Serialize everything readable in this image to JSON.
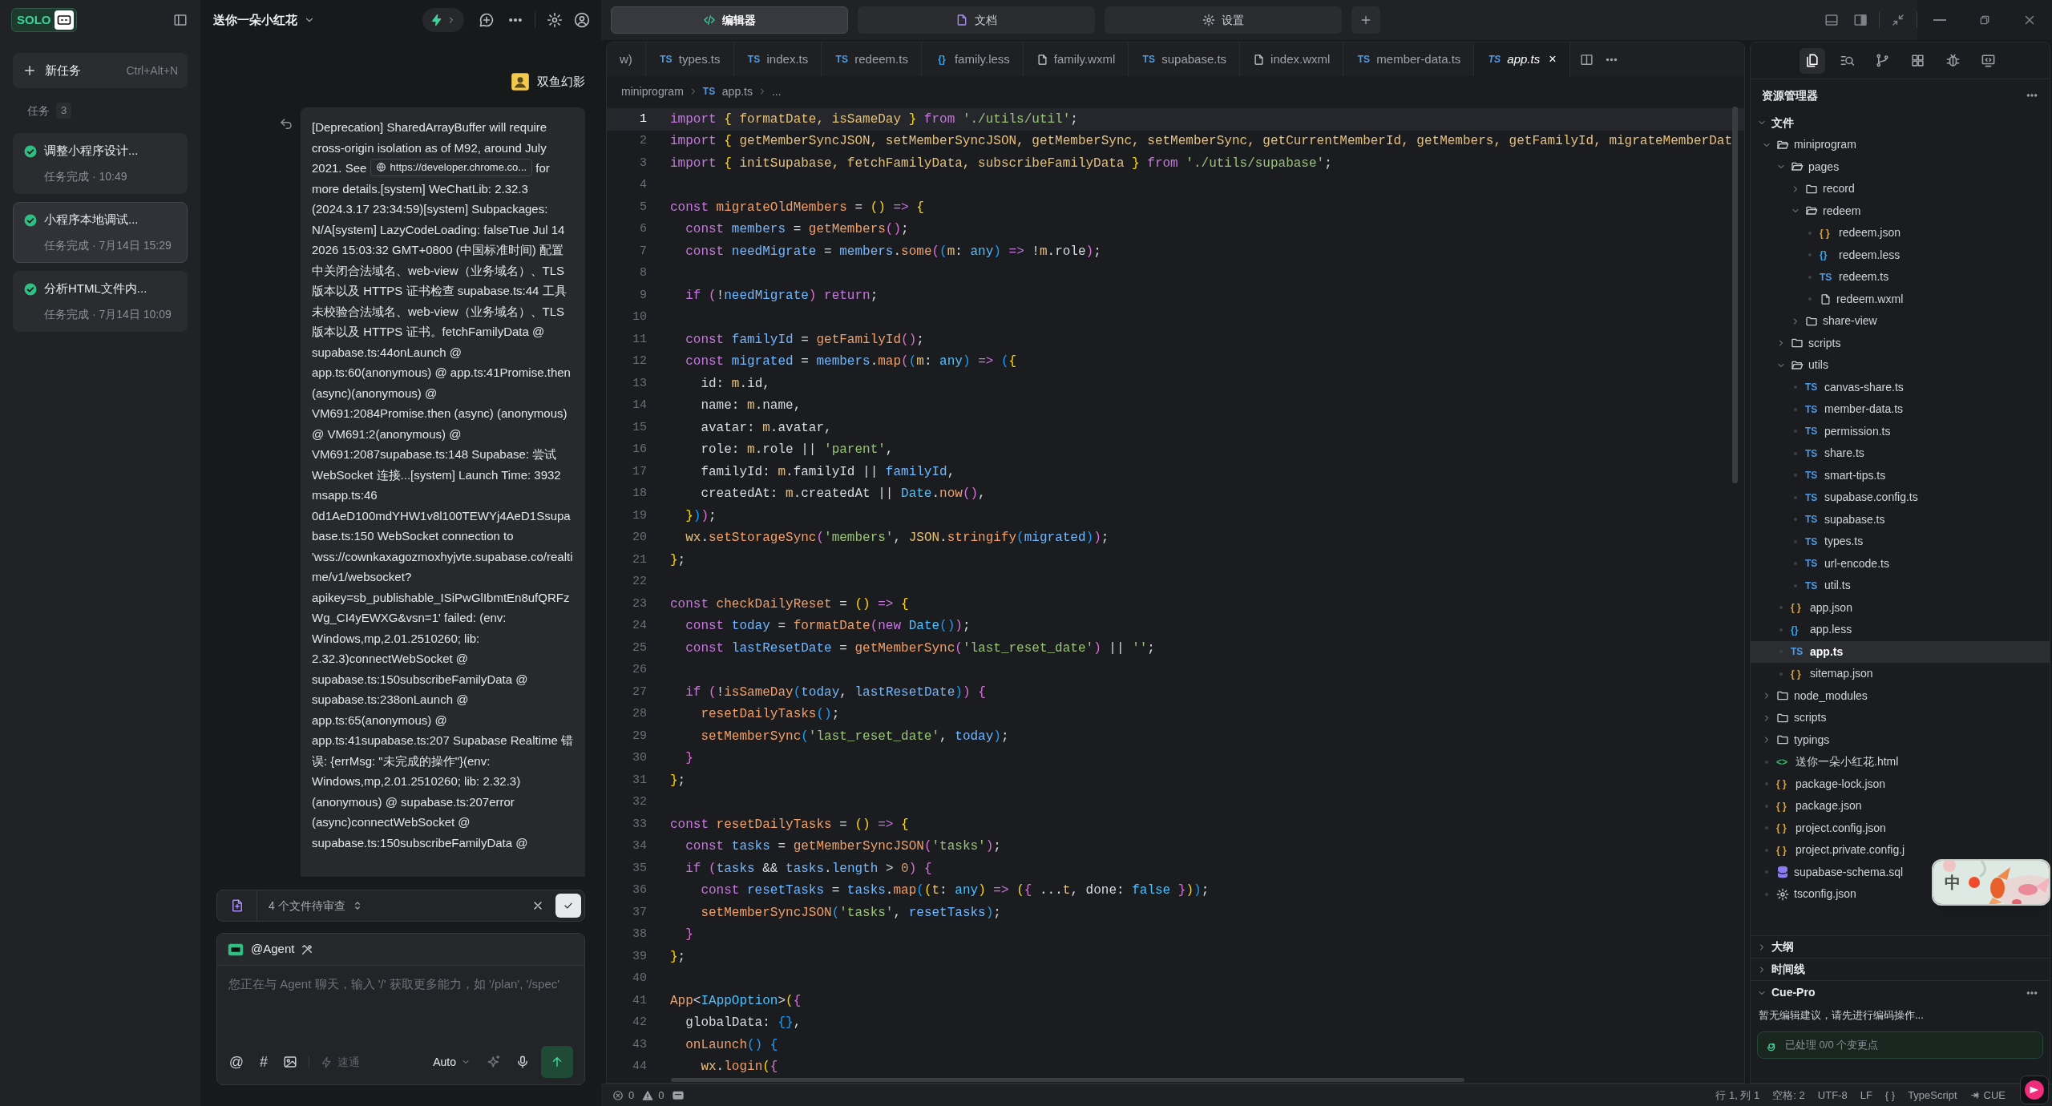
{
  "sidebar": {
    "logo": "SOLO",
    "new_task": {
      "label": "新任务",
      "shortcut": "Ctrl+Alt+N"
    },
    "tasks_heading": "任务",
    "tasks_count": "3",
    "tasks": [
      {
        "title": "调整小程序设计...",
        "status": "任务完成 · 10:49",
        "selected": false
      },
      {
        "title": "小程序本地调试...",
        "status": "任务完成 · 7月14日 15:29",
        "selected": true
      },
      {
        "title": "分析HTML文件内...",
        "status": "任务完成 · 7月14日 10:09",
        "selected": false
      }
    ]
  },
  "chat": {
    "title": "送你一朵小红花",
    "user": "双鱼幻影",
    "message": [
      {
        "kind": "text",
        "text": "[Deprecation] SharedArrayBuffer will require cross-origin isolation as of M92, around July 2021. See "
      },
      {
        "kind": "link",
        "text": "https://developer.chrome.co..."
      },
      {
        "kind": "text",
        "text": " for more details.[system] WeChatLib: 2.32.3 (2024.3.17 23:34:59)[system] Subpackages: N/A[system] LazyCodeLoading: falseTue Jul 14 2026 15:03:32 GMT+0800 (中国标准时间) 配置中关闭合法域名、web-view（业务域名）、TLS 版本以及 HTTPS 证书检查 supabase.ts:44 工具未校验合法域名、web-view（业务域名）、TLS 版本以及 HTTPS 证书。fetchFamilyData @ supabase.ts:44onLaunch @ app.ts:60(anonymous) @ app.ts:41Promise.then (async)(anonymous) @ VM691:2084Promise.then (async) (anonymous) @ VM691:2(anonymous) @ VM691:2087supabase.ts:148 Supabase: 尝试 WebSocket 连接...[system] Launch Time: 3932 msapp.ts:46 0d1AeD100mdYHW1v8l100TEWYj4AeD1Ssupabase.ts:150 WebSocket connection to 'wss://cownkaxagozmoxhyjvte.supabase.co/realtime/v1/websocket?apikey=sb_publishable_ISiPwGlIbmtEn8ufQRFzWg_CI4yEWXG&vsn=1' failed: (env: Windows,mp,2.01.2510260; lib: 2.32.3)connectWebSocket @ supabase.ts:150subscribeFamilyData @ supabase.ts:238onLaunch @ app.ts:65(anonymous) @ app.ts:41supabase.ts:207 Supabase Realtime 错误: {errMsg: \"未完成的操作\"}(env: Windows,mp,2.01.2510260; lib: 2.32.3) (anonymous) @ supabase.ts:207error (async)connectWebSocket @ supabase.ts:150subscribeFamilyData @"
      }
    ],
    "review": {
      "label": "4 个文件待审查"
    },
    "composer": {
      "agent": "@Agent",
      "placeholder": "您正在与 Agent 聊天，输入 '/' 获取更多能力，如 '/plan', '/spec'",
      "tools": [
        "@",
        "#"
      ],
      "mode": {
        "label": "速通",
        "disabled": true
      },
      "model": "Auto"
    }
  },
  "editor": {
    "tabs": [
      {
        "label": "编辑器",
        "selected": true
      },
      {
        "label": "文档",
        "selected": false
      },
      {
        "label": "设置",
        "selected": false
      }
    ],
    "file_tabs": [
      {
        "label": "w)",
        "kind": "partial",
        "selected": false
      },
      {
        "label": "types.ts",
        "kind": "ts",
        "icon": "TS",
        "selected": false
      },
      {
        "label": "index.ts",
        "kind": "ts",
        "icon": "TS",
        "selected": false
      },
      {
        "label": "redeem.ts",
        "kind": "ts",
        "icon": "TS",
        "selected": false
      },
      {
        "label": "family.less",
        "kind": "less",
        "icon": "{}",
        "selected": false
      },
      {
        "label": "family.wxml",
        "kind": "doc",
        "selected": false
      },
      {
        "label": "supabase.ts",
        "kind": "ts",
        "icon": "TS",
        "selected": false
      },
      {
        "label": "index.wxml",
        "kind": "doc",
        "selected": false
      },
      {
        "label": "member-data.ts",
        "kind": "ts",
        "icon": "TS",
        "selected": false
      },
      {
        "label": "app.ts",
        "kind": "ts",
        "icon": "TS",
        "selected": true,
        "close": "×"
      }
    ],
    "breadcrumb": [
      {
        "label": "miniprogram",
        "kind": "folder"
      },
      {
        "label": "app.ts",
        "kind": "ts",
        "icon": "TS"
      },
      {
        "label": "...",
        "kind": "more"
      }
    ],
    "lines": [
      {
        "number": "1",
        "current": true,
        "code": [
          {
            "text": "import ",
            "kind": "keyword"
          },
          {
            "text": "{ ",
            "kind": "bracket1"
          },
          {
            "text": "formatDate, isSameDay ",
            "kind": "import"
          },
          {
            "text": "} ",
            "kind": "bracket1"
          },
          {
            "text": "from ",
            "kind": "keyword"
          },
          {
            "text": "'./utils/util'",
            "kind": "string"
          },
          {
            "text": ";",
            "kind": "plain"
          }
        ]
      },
      {
        "number": "2",
        "current": false,
        "code": [
          {
            "text": "import ",
            "kind": "keyword"
          },
          {
            "text": "{ ",
            "kind": "bracket1"
          },
          {
            "text": "getMemberSyncJSON, setMemberSyncJSON, getMemberSync, setMemberSync, getCurrentMemberId, getMembers, getFamilyId, migrateMemberDat",
            "kind": "import"
          }
        ]
      },
      {
        "number": "3",
        "current": false,
        "code": [
          {
            "text": "import ",
            "kind": "keyword"
          },
          {
            "text": "{ ",
            "kind": "bracket1"
          },
          {
            "text": "initSupabase, fetchFamilyData, subscribeFamilyData ",
            "kind": "import"
          },
          {
            "text": "} ",
            "kind": "bracket1"
          },
          {
            "text": "from ",
            "kind": "keyword"
          },
          {
            "text": "'./utils/supabase'",
            "kind": "string"
          },
          {
            "text": ";",
            "kind": "plain"
          }
        ]
      },
      {
        "number": "4",
        "current": false
      },
      {
        "number": "5",
        "current": false,
        "code": [
          {
            "text": "const ",
            "kind": "keyword"
          },
          {
            "text": "migrateOldMembers",
            "kind": "call"
          },
          {
            "text": " = ",
            "kind": "plain"
          },
          {
            "text": "() ",
            "kind": "bracket1"
          },
          {
            "text": "=> ",
            "kind": "keyword"
          },
          {
            "text": "{",
            "kind": "bracket1"
          }
        ]
      },
      {
        "number": "6",
        "current": false,
        "code": [
          {
            "text": "  const ",
            "kind": "keyword"
          },
          {
            "text": "members",
            "kind": "variable"
          },
          {
            "text": " = ",
            "kind": "plain"
          },
          {
            "text": "getMembers",
            "kind": "call"
          },
          {
            "text": "()",
            "kind": "bracket2"
          },
          {
            "text": ";",
            "kind": "plain"
          }
        ]
      },
      {
        "number": "7",
        "current": false,
        "code": [
          {
            "text": "  const ",
            "kind": "keyword"
          },
          {
            "text": "needMigrate",
            "kind": "variable"
          },
          {
            "text": " = ",
            "kind": "plain"
          },
          {
            "text": "members",
            "kind": "variable"
          },
          {
            "text": ".",
            "kind": "plain"
          },
          {
            "text": "some",
            "kind": "call"
          },
          {
            "text": "(",
            "kind": "bracket2"
          },
          {
            "text": "(",
            "kind": "bracket3"
          },
          {
            "text": "m",
            "kind": "param"
          },
          {
            "text": ": ",
            "kind": "plain"
          },
          {
            "text": "any",
            "kind": "type"
          },
          {
            "text": ") ",
            "kind": "bracket3"
          },
          {
            "text": "=> ",
            "kind": "keyword"
          },
          {
            "text": "!",
            "kind": "plain"
          },
          {
            "text": "m",
            "kind": "param"
          },
          {
            "text": ".role",
            "kind": "plain"
          },
          {
            "text": ")",
            "kind": "bracket2"
          },
          {
            "text": ";",
            "kind": "plain"
          }
        ]
      },
      {
        "number": "8",
        "current": false
      },
      {
        "number": "9",
        "current": false,
        "code": [
          {
            "text": "  if ",
            "kind": "keyword"
          },
          {
            "text": "(",
            "kind": "bracket2"
          },
          {
            "text": "!",
            "kind": "plain"
          },
          {
            "text": "needMigrate",
            "kind": "variable"
          },
          {
            "text": ") ",
            "kind": "bracket2"
          },
          {
            "text": "return",
            "kind": "keyword"
          },
          {
            "text": ";",
            "kind": "plain"
          }
        ]
      },
      {
        "number": "10",
        "current": false
      },
      {
        "number": "11",
        "current": false,
        "code": [
          {
            "text": "  const ",
            "kind": "keyword"
          },
          {
            "text": "familyId",
            "kind": "variable"
          },
          {
            "text": " = ",
            "kind": "plain"
          },
          {
            "text": "getFamilyId",
            "kind": "call"
          },
          {
            "text": "()",
            "kind": "bracket2"
          },
          {
            "text": ";",
            "kind": "plain"
          }
        ]
      },
      {
        "number": "12",
        "current": false,
        "code": [
          {
            "text": "  const ",
            "kind": "keyword"
          },
          {
            "text": "migrated",
            "kind": "variable"
          },
          {
            "text": " = ",
            "kind": "plain"
          },
          {
            "text": "members",
            "kind": "variable"
          },
          {
            "text": ".",
            "kind": "plain"
          },
          {
            "text": "map",
            "kind": "call"
          },
          {
            "text": "(",
            "kind": "bracket2"
          },
          {
            "text": "(",
            "kind": "bracket3"
          },
          {
            "text": "m",
            "kind": "param"
          },
          {
            "text": ": ",
            "kind": "plain"
          },
          {
            "text": "any",
            "kind": "type"
          },
          {
            "text": ") ",
            "kind": "bracket3"
          },
          {
            "text": "=> ",
            "kind": "keyword"
          },
          {
            "text": "(",
            "kind": "bracket3"
          },
          {
            "text": "{",
            "kind": "bracket1"
          }
        ]
      },
      {
        "number": "13",
        "current": false,
        "code": [
          {
            "text": "    id: ",
            "kind": "plain"
          },
          {
            "text": "m",
            "kind": "param"
          },
          {
            "text": ".id,",
            "kind": "plain"
          }
        ]
      },
      {
        "number": "14",
        "current": false,
        "code": [
          {
            "text": "    name: ",
            "kind": "plain"
          },
          {
            "text": "m",
            "kind": "param"
          },
          {
            "text": ".name,",
            "kind": "plain"
          }
        ]
      },
      {
        "number": "15",
        "current": false,
        "code": [
          {
            "text": "    avatar: ",
            "kind": "plain"
          },
          {
            "text": "m",
            "kind": "param"
          },
          {
            "text": ".avatar,",
            "kind": "plain"
          }
        ]
      },
      {
        "number": "16",
        "current": false,
        "code": [
          {
            "text": "    role: ",
            "kind": "plain"
          },
          {
            "text": "m",
            "kind": "param"
          },
          {
            "text": ".role || ",
            "kind": "plain"
          },
          {
            "text": "'parent'",
            "kind": "string"
          },
          {
            "text": ",",
            "kind": "plain"
          }
        ]
      },
      {
        "number": "17",
        "current": false,
        "code": [
          {
            "text": "    familyId: ",
            "kind": "plain"
          },
          {
            "text": "m",
            "kind": "param"
          },
          {
            "text": ".familyId || ",
            "kind": "plain"
          },
          {
            "text": "familyId",
            "kind": "variable"
          },
          {
            "text": ",",
            "kind": "plain"
          }
        ]
      },
      {
        "number": "18",
        "current": false,
        "code": [
          {
            "text": "    createdAt: ",
            "kind": "plain"
          },
          {
            "text": "m",
            "kind": "param"
          },
          {
            "text": ".createdAt || ",
            "kind": "plain"
          },
          {
            "text": "Date",
            "kind": "type"
          },
          {
            "text": ".",
            "kind": "plain"
          },
          {
            "text": "now",
            "kind": "call"
          },
          {
            "text": "()",
            "kind": "bracket2"
          },
          {
            "text": ",",
            "kind": "plain"
          }
        ]
      },
      {
        "number": "19",
        "current": false,
        "code": [
          {
            "text": "  }",
            "kind": "bracket1"
          },
          {
            "text": ")",
            "kind": "bracket3"
          },
          {
            "text": ")",
            "kind": "bracket2"
          },
          {
            "text": ";",
            "kind": "plain"
          }
        ]
      },
      {
        "number": "20",
        "current": false,
        "code": [
          {
            "text": "  wx",
            "kind": "import"
          },
          {
            "text": ".",
            "kind": "plain"
          },
          {
            "text": "setStorageSync",
            "kind": "call"
          },
          {
            "text": "(",
            "kind": "bracket2"
          },
          {
            "text": "'members'",
            "kind": "string"
          },
          {
            "text": ", ",
            "kind": "plain"
          },
          {
            "text": "JSON",
            "kind": "import"
          },
          {
            "text": ".",
            "kind": "plain"
          },
          {
            "text": "stringify",
            "kind": "call"
          },
          {
            "text": "(",
            "kind": "bracket3"
          },
          {
            "text": "migrated",
            "kind": "variable"
          },
          {
            "text": ")",
            "kind": "bracket3"
          },
          {
            "text": ")",
            "kind": "bracket2"
          },
          {
            "text": ";",
            "kind": "plain"
          }
        ]
      },
      {
        "number": "21",
        "current": false,
        "code": [
          {
            "text": "}",
            "kind": "bracket1"
          },
          {
            "text": ";",
            "kind": "plain"
          }
        ]
      },
      {
        "number": "22",
        "current": false
      },
      {
        "number": "23",
        "current": false,
        "code": [
          {
            "text": "const ",
            "kind": "keyword"
          },
          {
            "text": "checkDailyReset",
            "kind": "call"
          },
          {
            "text": " = ",
            "kind": "plain"
          },
          {
            "text": "() ",
            "kind": "bracket1"
          },
          {
            "text": "=> ",
            "kind": "keyword"
          },
          {
            "text": "{",
            "kind": "bracket1"
          }
        ]
      },
      {
        "number": "24",
        "current": false,
        "code": [
          {
            "text": "  const ",
            "kind": "keyword"
          },
          {
            "text": "today",
            "kind": "variable"
          },
          {
            "text": " = ",
            "kind": "plain"
          },
          {
            "text": "formatDate",
            "kind": "call"
          },
          {
            "text": "(",
            "kind": "bracket2"
          },
          {
            "text": "new ",
            "kind": "keyword"
          },
          {
            "text": "Date",
            "kind": "type"
          },
          {
            "text": "()",
            "kind": "bracket3"
          },
          {
            "text": ")",
            "kind": "bracket2"
          },
          {
            "text": ";",
            "kind": "plain"
          }
        ]
      },
      {
        "number": "25",
        "current": false,
        "code": [
          {
            "text": "  const ",
            "kind": "keyword"
          },
          {
            "text": "lastResetDate",
            "kind": "variable"
          },
          {
            "text": " = ",
            "kind": "plain"
          },
          {
            "text": "getMemberSync",
            "kind": "call"
          },
          {
            "text": "(",
            "kind": "bracket2"
          },
          {
            "text": "'last_reset_date'",
            "kind": "string"
          },
          {
            "text": ")",
            "kind": "bracket2"
          },
          {
            "text": " || ",
            "kind": "plain"
          },
          {
            "text": "''",
            "kind": "string"
          },
          {
            "text": ";",
            "kind": "plain"
          }
        ]
      },
      {
        "number": "26",
        "current": false
      },
      {
        "number": "27",
        "current": false,
        "code": [
          {
            "text": "  if ",
            "kind": "keyword"
          },
          {
            "text": "(",
            "kind": "bracket2"
          },
          {
            "text": "!",
            "kind": "plain"
          },
          {
            "text": "isSameDay",
            "kind": "call"
          },
          {
            "text": "(",
            "kind": "bracket3"
          },
          {
            "text": "today",
            "kind": "variable"
          },
          {
            "text": ", ",
            "kind": "plain"
          },
          {
            "text": "lastResetDate",
            "kind": "variable"
          },
          {
            "text": ")",
            "kind": "bracket3"
          },
          {
            "text": ") ",
            "kind": "bracket2"
          },
          {
            "text": "{",
            "kind": "bracket2"
          }
        ]
      },
      {
        "number": "28",
        "current": false,
        "code": [
          {
            "text": "    resetDailyTasks",
            "kind": "call"
          },
          {
            "text": "()",
            "kind": "bracket3"
          },
          {
            "text": ";",
            "kind": "plain"
          }
        ]
      },
      {
        "number": "29",
        "current": false,
        "code": [
          {
            "text": "    setMemberSync",
            "kind": "call"
          },
          {
            "text": "(",
            "kind": "bracket3"
          },
          {
            "text": "'last_reset_date'",
            "kind": "string"
          },
          {
            "text": ", ",
            "kind": "plain"
          },
          {
            "text": "today",
            "kind": "variable"
          },
          {
            "text": ")",
            "kind": "bracket3"
          },
          {
            "text": ";",
            "kind": "plain"
          }
        ]
      },
      {
        "number": "30",
        "current": false,
        "code": [
          {
            "text": "  }",
            "kind": "bracket2"
          }
        ]
      },
      {
        "number": "31",
        "current": false,
        "code": [
          {
            "text": "}",
            "kind": "bracket1"
          },
          {
            "text": ";",
            "kind": "plain"
          }
        ]
      },
      {
        "number": "32",
        "current": false
      },
      {
        "number": "33",
        "current": false,
        "code": [
          {
            "text": "const ",
            "kind": "keyword"
          },
          {
            "text": "resetDailyTasks",
            "kind": "call"
          },
          {
            "text": " = ",
            "kind": "plain"
          },
          {
            "text": "() ",
            "kind": "bracket1"
          },
          {
            "text": "=> ",
            "kind": "keyword"
          },
          {
            "text": "{",
            "kind": "bracket1"
          }
        ]
      },
      {
        "number": "34",
        "current": false,
        "code": [
          {
            "text": "  const ",
            "kind": "keyword"
          },
          {
            "text": "tasks",
            "kind": "variable"
          },
          {
            "text": " = ",
            "kind": "plain"
          },
          {
            "text": "getMemberSyncJSON",
            "kind": "call"
          },
          {
            "text": "(",
            "kind": "bracket2"
          },
          {
            "text": "'tasks'",
            "kind": "string"
          },
          {
            "text": ")",
            "kind": "bracket2"
          },
          {
            "text": ";",
            "kind": "plain"
          }
        ]
      },
      {
        "number": "35",
        "current": false,
        "code": [
          {
            "text": "  if ",
            "kind": "keyword"
          },
          {
            "text": "(",
            "kind": "bracket2"
          },
          {
            "text": "tasks",
            "kind": "variable"
          },
          {
            "text": " && ",
            "kind": "plain"
          },
          {
            "text": "tasks",
            "kind": "variable"
          },
          {
            "text": ".",
            "kind": "plain"
          },
          {
            "text": "length",
            "kind": "variable"
          },
          {
            "text": " > ",
            "kind": "plain"
          },
          {
            "text": "0",
            "kind": "number"
          },
          {
            "text": ") ",
            "kind": "bracket2"
          },
          {
            "text": "{",
            "kind": "bracket2"
          }
        ]
      },
      {
        "number": "36",
        "current": false,
        "code": [
          {
            "text": "    const ",
            "kind": "keyword"
          },
          {
            "text": "resetTasks",
            "kind": "variable"
          },
          {
            "text": " = ",
            "kind": "plain"
          },
          {
            "text": "tasks",
            "kind": "variable"
          },
          {
            "text": ".",
            "kind": "plain"
          },
          {
            "text": "map",
            "kind": "call"
          },
          {
            "text": "(",
            "kind": "bracket3"
          },
          {
            "text": "(",
            "kind": "bracket1"
          },
          {
            "text": "t",
            "kind": "param"
          },
          {
            "text": ": ",
            "kind": "plain"
          },
          {
            "text": "any",
            "kind": "type"
          },
          {
            "text": ") ",
            "kind": "bracket1"
          },
          {
            "text": "=> ",
            "kind": "keyword"
          },
          {
            "text": "(",
            "kind": "bracket1"
          },
          {
            "text": "{ ",
            "kind": "bracket2"
          },
          {
            "text": "...",
            "kind": "plain"
          },
          {
            "text": "t",
            "kind": "param"
          },
          {
            "text": ", done: ",
            "kind": "plain"
          },
          {
            "text": "false ",
            "kind": "type"
          },
          {
            "text": "}",
            "kind": "bracket2"
          },
          {
            "text": ")",
            "kind": "bracket1"
          },
          {
            "text": ")",
            "kind": "bracket3"
          },
          {
            "text": ";",
            "kind": "plain"
          }
        ]
      },
      {
        "number": "37",
        "current": false,
        "code": [
          {
            "text": "    setMemberSyncJSON",
            "kind": "call"
          },
          {
            "text": "(",
            "kind": "bracket3"
          },
          {
            "text": "'tasks'",
            "kind": "string"
          },
          {
            "text": ", ",
            "kind": "plain"
          },
          {
            "text": "resetTasks",
            "kind": "variable"
          },
          {
            "text": ")",
            "kind": "bracket3"
          },
          {
            "text": ";",
            "kind": "plain"
          }
        ]
      },
      {
        "number": "38",
        "current": false,
        "code": [
          {
            "text": "  }",
            "kind": "bracket2"
          }
        ]
      },
      {
        "number": "39",
        "current": false,
        "code": [
          {
            "text": "}",
            "kind": "bracket1"
          },
          {
            "text": ";",
            "kind": "plain"
          }
        ]
      },
      {
        "number": "40",
        "current": false
      },
      {
        "number": "41",
        "current": false,
        "code": [
          {
            "text": "App",
            "kind": "call"
          },
          {
            "text": "<",
            "kind": "plain"
          },
          {
            "text": "IAppOption",
            "kind": "type"
          },
          {
            "text": ">",
            "kind": "plain"
          },
          {
            "text": "(",
            "kind": "bracket1"
          },
          {
            "text": "{",
            "kind": "bracket2"
          }
        ]
      },
      {
        "number": "42",
        "current": false,
        "code": [
          {
            "text": "  globalData: ",
            "kind": "plain"
          },
          {
            "text": "{}",
            "kind": "bracket3"
          },
          {
            "text": ",",
            "kind": "plain"
          }
        ]
      },
      {
        "number": "43",
        "current": false,
        "code": [
          {
            "text": "  onLaunch",
            "kind": "call"
          },
          {
            "text": "() ",
            "kind": "bracket3"
          },
          {
            "text": "{",
            "kind": "bracket3"
          }
        ]
      },
      {
        "number": "44",
        "current": false,
        "code": [
          {
            "text": "    wx",
            "kind": "import"
          },
          {
            "text": ".",
            "kind": "plain"
          },
          {
            "text": "login",
            "kind": "call"
          },
          {
            "text": "(",
            "kind": "bracket1"
          },
          {
            "text": "{",
            "kind": "bracket2"
          }
        ]
      }
    ]
  },
  "explorer": {
    "title": "资源管理器",
    "files_section": {
      "label": "文件",
      "expanded": true
    },
    "tree": [
      {
        "name": "miniprogram",
        "kind": "folder",
        "expanded": true,
        "selected": false,
        "children": [
          {
            "name": "pages",
            "kind": "folder",
            "expanded": true,
            "selected": false,
            "children": [
              {
                "name": "record",
                "kind": "folder",
                "expanded": false,
                "selected": false
              },
              {
                "name": "redeem",
                "kind": "folder",
                "expanded": true,
                "selected": false,
                "children": [
                  {
                    "name": "redeem.json",
                    "kind": "json",
                    "icon": "{ }",
                    "selected": false
                  },
                  {
                    "name": "redeem.less",
                    "kind": "less",
                    "icon": "{}",
                    "selected": false
                  },
                  {
                    "name": "redeem.ts",
                    "kind": "ts",
                    "icon": "TS",
                    "selected": false
                  },
                  {
                    "name": "redeem.wxml",
                    "kind": "doc",
                    "selected": false
                  }
                ]
              },
              {
                "name": "share-view",
                "kind": "folder",
                "expanded": false,
                "selected": false
              }
            ]
          },
          {
            "name": "scripts",
            "kind": "folder",
            "expanded": false,
            "selected": false
          },
          {
            "name": "utils",
            "kind": "folder",
            "expanded": true,
            "selected": false,
            "children": [
              {
                "name": "canvas-share.ts",
                "kind": "ts",
                "icon": "TS",
                "selected": false
              },
              {
                "name": "member-data.ts",
                "kind": "ts",
                "icon": "TS",
                "selected": false
              },
              {
                "name": "permission.ts",
                "kind": "ts",
                "icon": "TS",
                "selected": false
              },
              {
                "name": "share.ts",
                "kind": "ts",
                "icon": "TS",
                "selected": false
              },
              {
                "name": "smart-tips.ts",
                "kind": "ts",
                "icon": "TS",
                "selected": false
              },
              {
                "name": "supabase.config.ts",
                "kind": "ts",
                "icon": "TS",
                "selected": false
              },
              {
                "name": "supabase.ts",
                "kind": "ts",
                "icon": "TS",
                "selected": false
              },
              {
                "name": "types.ts",
                "kind": "ts",
                "icon": "TS",
                "selected": false
              },
              {
                "name": "url-encode.ts",
                "kind": "ts",
                "icon": "TS",
                "selected": false
              },
              {
                "name": "util.ts",
                "kind": "ts",
                "icon": "TS",
                "selected": false
              }
            ]
          },
          {
            "name": "app.json",
            "kind": "json",
            "icon": "{ }",
            "selected": false
          },
          {
            "name": "app.less",
            "kind": "less",
            "icon": "{}",
            "selected": false
          },
          {
            "name": "app.ts",
            "kind": "ts",
            "icon": "TS",
            "selected": true
          },
          {
            "name": "sitemap.json",
            "kind": "json",
            "icon": "{ }",
            "selected": false
          }
        ]
      },
      {
        "name": "node_modules",
        "kind": "folder",
        "expanded": false,
        "selected": false
      },
      {
        "name": "scripts",
        "kind": "folder",
        "expanded": false,
        "selected": false
      },
      {
        "name": "typings",
        "kind": "folder",
        "expanded": false,
        "selected": false
      },
      {
        "name": "送你一朵小红花.html",
        "kind": "html",
        "icon": "<>",
        "selected": false
      },
      {
        "name": "package-lock.json",
        "kind": "json",
        "icon": "{ }",
        "selected": false
      },
      {
        "name": "package.json",
        "kind": "json",
        "icon": "{ }",
        "selected": false
      },
      {
        "name": "project.config.json",
        "kind": "json",
        "icon": "{ }",
        "selected": false
      },
      {
        "name": "project.private.config.j",
        "kind": "json",
        "icon": "{ }",
        "selected": false
      },
      {
        "name": "supabase-schema.sql",
        "kind": "database",
        "selected": false
      },
      {
        "name": "tsconfig.json",
        "kind": "config",
        "selected": false
      }
    ],
    "sections": [
      {
        "label": "大纲",
        "expanded": false
      },
      {
        "label": "时间线",
        "expanded": false
      }
    ],
    "cue": {
      "title": "Cue-Pro",
      "expanded": true,
      "message": "暂无编辑建议，请先进行编码操作...",
      "progress": "已处理 0/0 个变更点"
    }
  },
  "ime": {
    "label": "中"
  },
  "status_bar": {
    "errors": "0",
    "warnings": "0",
    "position": "行 1, 列 1",
    "indent": "空格: 2",
    "encoding": "UTF-8",
    "eol": "LF",
    "braces": "{ }",
    "language": "TypeScript",
    "extension": "CUE"
  }
}
